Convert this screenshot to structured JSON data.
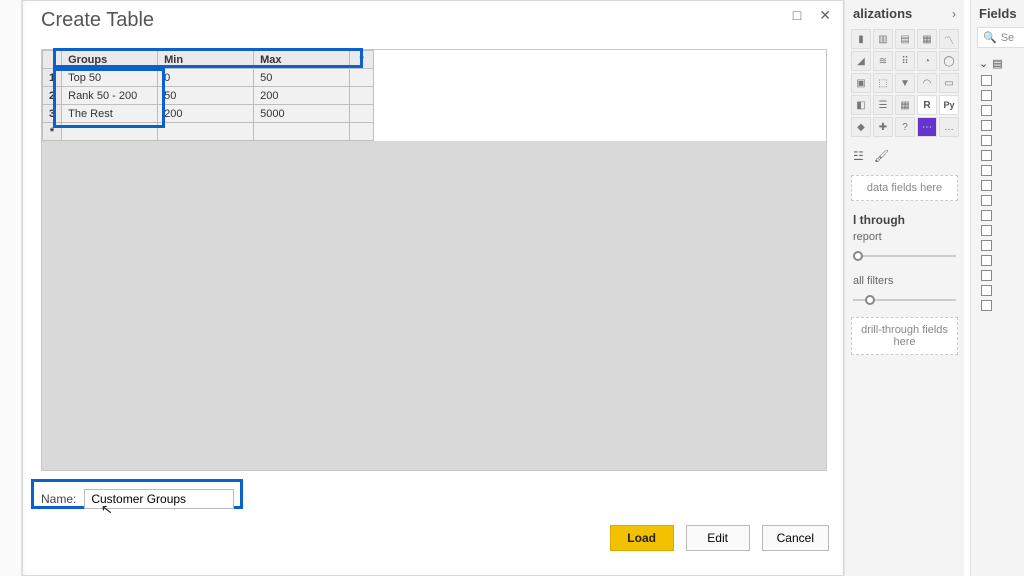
{
  "dialog": {
    "title": "Create Table",
    "window_controls": {
      "max": "□",
      "close": "✕"
    },
    "columns": {
      "groups": "Groups",
      "min": "Min",
      "max": "Max",
      "asterisk": "*"
    },
    "rows": [
      {
        "n": "1",
        "groups": "Top 50",
        "min": "0",
        "max": "50"
      },
      {
        "n": "2",
        "groups": "Rank 50 - 200",
        "min": "50",
        "max": "200"
      },
      {
        "n": "3",
        "groups": "The Rest",
        "min": "200",
        "max": "5000"
      }
    ],
    "new_row_marker": "*",
    "name_label": "Name:",
    "name_value": "Customer Groups",
    "buttons": {
      "load": "Load",
      "edit": "Edit",
      "cancel": "Cancel"
    }
  },
  "viz": {
    "title": "alizations",
    "caret": "›",
    "data_drop": "data fields here",
    "drill_title": "l through",
    "cross_report": "report",
    "all_filters": "all filters",
    "drill_drop": "drill-through fields here",
    "r_label": "R",
    "py_label": "Py"
  },
  "fields": {
    "title": "Fields",
    "search_placeholder": "Se",
    "table_icon": "▤",
    "caret_down": "⌄"
  }
}
